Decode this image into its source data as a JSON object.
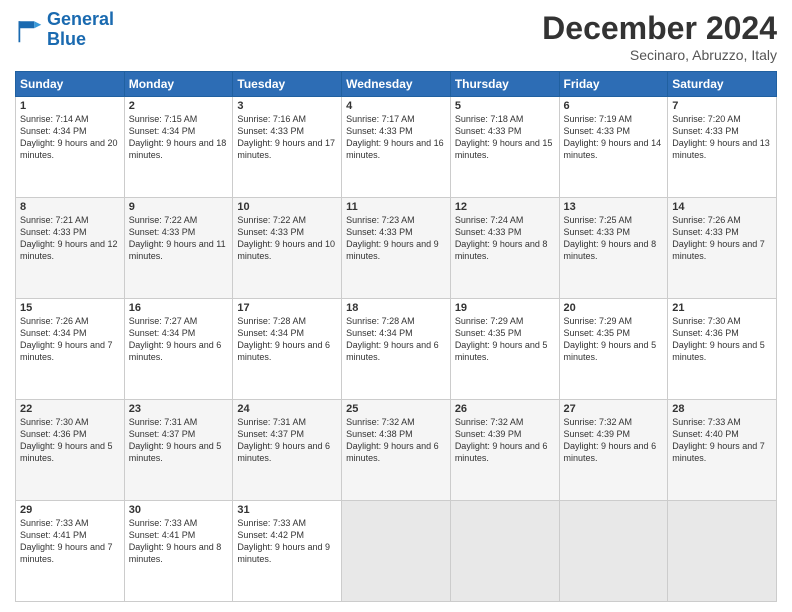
{
  "logo": {
    "line1": "General",
    "line2": "Blue"
  },
  "title": "December 2024",
  "subtitle": "Secinaro, Abruzzo, Italy",
  "headers": [
    "Sunday",
    "Monday",
    "Tuesday",
    "Wednesday",
    "Thursday",
    "Friday",
    "Saturday"
  ],
  "weeks": [
    [
      {
        "day": "1",
        "sunrise": "7:14 AM",
        "sunset": "4:34 PM",
        "daylight": "9 hours and 20 minutes."
      },
      {
        "day": "2",
        "sunrise": "7:15 AM",
        "sunset": "4:34 PM",
        "daylight": "9 hours and 18 minutes."
      },
      {
        "day": "3",
        "sunrise": "7:16 AM",
        "sunset": "4:33 PM",
        "daylight": "9 hours and 17 minutes."
      },
      {
        "day": "4",
        "sunrise": "7:17 AM",
        "sunset": "4:33 PM",
        "daylight": "9 hours and 16 minutes."
      },
      {
        "day": "5",
        "sunrise": "7:18 AM",
        "sunset": "4:33 PM",
        "daylight": "9 hours and 15 minutes."
      },
      {
        "day": "6",
        "sunrise": "7:19 AM",
        "sunset": "4:33 PM",
        "daylight": "9 hours and 14 minutes."
      },
      {
        "day": "7",
        "sunrise": "7:20 AM",
        "sunset": "4:33 PM",
        "daylight": "9 hours and 13 minutes."
      }
    ],
    [
      {
        "day": "8",
        "sunrise": "7:21 AM",
        "sunset": "4:33 PM",
        "daylight": "9 hours and 12 minutes."
      },
      {
        "day": "9",
        "sunrise": "7:22 AM",
        "sunset": "4:33 PM",
        "daylight": "9 hours and 11 minutes."
      },
      {
        "day": "10",
        "sunrise": "7:22 AM",
        "sunset": "4:33 PM",
        "daylight": "9 hours and 10 minutes."
      },
      {
        "day": "11",
        "sunrise": "7:23 AM",
        "sunset": "4:33 PM",
        "daylight": "9 hours and 9 minutes."
      },
      {
        "day": "12",
        "sunrise": "7:24 AM",
        "sunset": "4:33 PM",
        "daylight": "9 hours and 8 minutes."
      },
      {
        "day": "13",
        "sunrise": "7:25 AM",
        "sunset": "4:33 PM",
        "daylight": "9 hours and 8 minutes."
      },
      {
        "day": "14",
        "sunrise": "7:26 AM",
        "sunset": "4:33 PM",
        "daylight": "9 hours and 7 minutes."
      }
    ],
    [
      {
        "day": "15",
        "sunrise": "7:26 AM",
        "sunset": "4:34 PM",
        "daylight": "9 hours and 7 minutes."
      },
      {
        "day": "16",
        "sunrise": "7:27 AM",
        "sunset": "4:34 PM",
        "daylight": "9 hours and 6 minutes."
      },
      {
        "day": "17",
        "sunrise": "7:28 AM",
        "sunset": "4:34 PM",
        "daylight": "9 hours and 6 minutes."
      },
      {
        "day": "18",
        "sunrise": "7:28 AM",
        "sunset": "4:34 PM",
        "daylight": "9 hours and 6 minutes."
      },
      {
        "day": "19",
        "sunrise": "7:29 AM",
        "sunset": "4:35 PM",
        "daylight": "9 hours and 5 minutes."
      },
      {
        "day": "20",
        "sunrise": "7:29 AM",
        "sunset": "4:35 PM",
        "daylight": "9 hours and 5 minutes."
      },
      {
        "day": "21",
        "sunrise": "7:30 AM",
        "sunset": "4:36 PM",
        "daylight": "9 hours and 5 minutes."
      }
    ],
    [
      {
        "day": "22",
        "sunrise": "7:30 AM",
        "sunset": "4:36 PM",
        "daylight": "9 hours and 5 minutes."
      },
      {
        "day": "23",
        "sunrise": "7:31 AM",
        "sunset": "4:37 PM",
        "daylight": "9 hours and 5 minutes."
      },
      {
        "day": "24",
        "sunrise": "7:31 AM",
        "sunset": "4:37 PM",
        "daylight": "9 hours and 6 minutes."
      },
      {
        "day": "25",
        "sunrise": "7:32 AM",
        "sunset": "4:38 PM",
        "daylight": "9 hours and 6 minutes."
      },
      {
        "day": "26",
        "sunrise": "7:32 AM",
        "sunset": "4:39 PM",
        "daylight": "9 hours and 6 minutes."
      },
      {
        "day": "27",
        "sunrise": "7:32 AM",
        "sunset": "4:39 PM",
        "daylight": "9 hours and 6 minutes."
      },
      {
        "day": "28",
        "sunrise": "7:33 AM",
        "sunset": "4:40 PM",
        "daylight": "9 hours and 7 minutes."
      }
    ],
    [
      {
        "day": "29",
        "sunrise": "7:33 AM",
        "sunset": "4:41 PM",
        "daylight": "9 hours and 7 minutes."
      },
      {
        "day": "30",
        "sunrise": "7:33 AM",
        "sunset": "4:41 PM",
        "daylight": "9 hours and 8 minutes."
      },
      {
        "day": "31",
        "sunrise": "7:33 AM",
        "sunset": "4:42 PM",
        "daylight": "9 hours and 9 minutes."
      },
      null,
      null,
      null,
      null
    ]
  ]
}
